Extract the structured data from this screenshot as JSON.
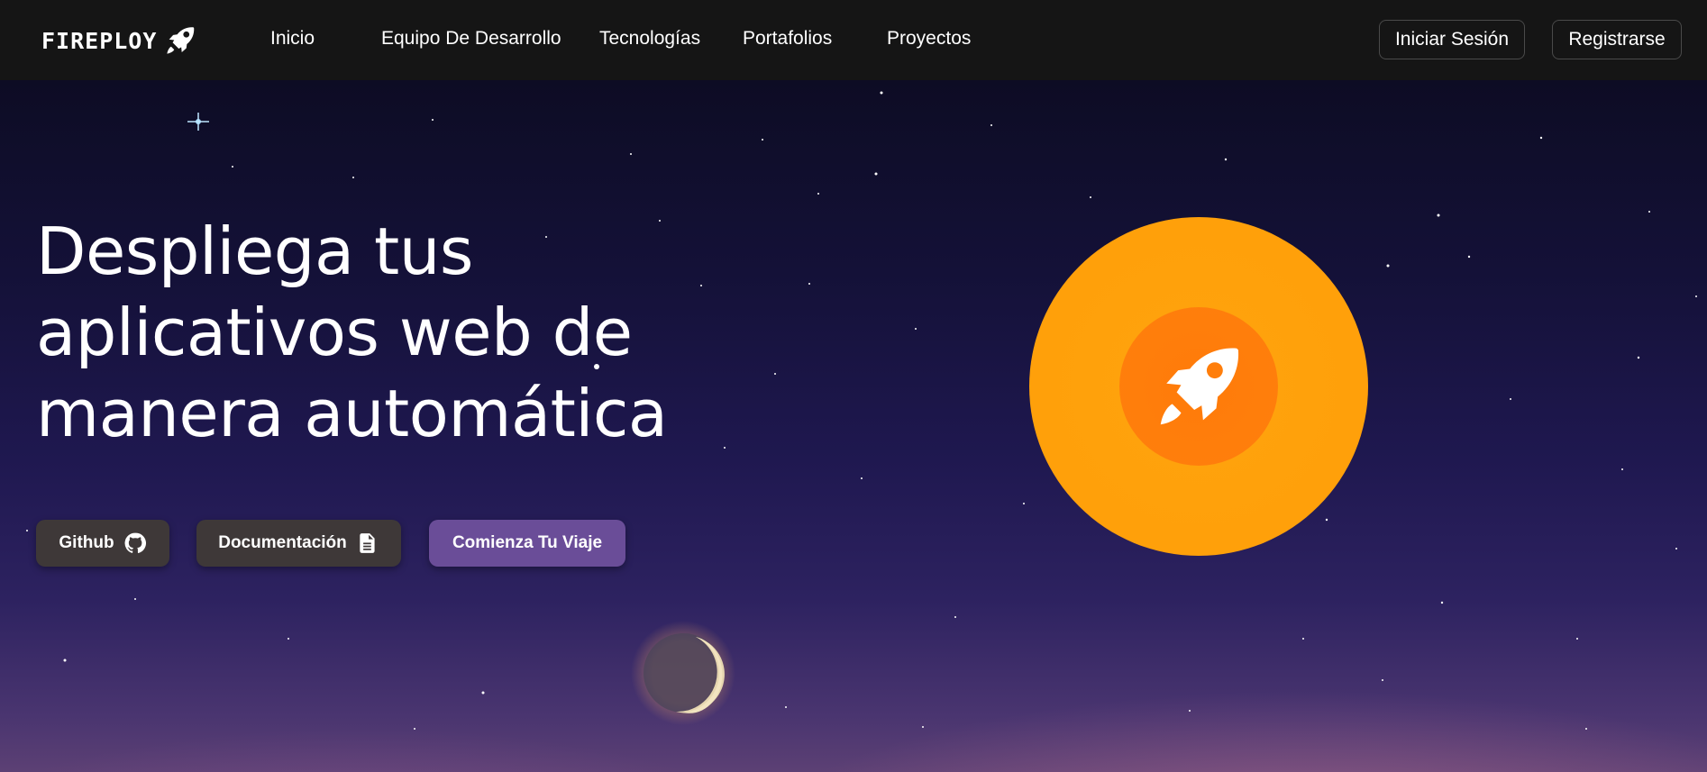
{
  "navbar": {
    "brand": "FIREPLOY",
    "brand_icon": "rocket-icon",
    "links": [
      "Inicio",
      "Equipo De Desarrollo",
      "Tecnologías",
      "Portafolios",
      "Proyectos"
    ],
    "login_label": "Iniciar Sesión",
    "register_label": "Registrarse"
  },
  "hero": {
    "headline_lines": [
      "Despliega tus",
      "aplicativos web de",
      "manera automática"
    ],
    "buttons": {
      "github_label": "Github",
      "github_icon": "github-icon",
      "docs_label": "Documentación",
      "docs_icon": "document-icon",
      "start_label": "Comienza Tu Viaje"
    },
    "feature_icon": "rocket-icon"
  },
  "colors": {
    "navbar_bg": "#151515",
    "sun_orange": "#ffa00a",
    "sun_inner": "#ff7e0b",
    "primary_button": "#6a4d98",
    "secondary_button": "#3e3838",
    "sky_top": "#0d0c24",
    "sky_bottom": "#5c4074"
  }
}
